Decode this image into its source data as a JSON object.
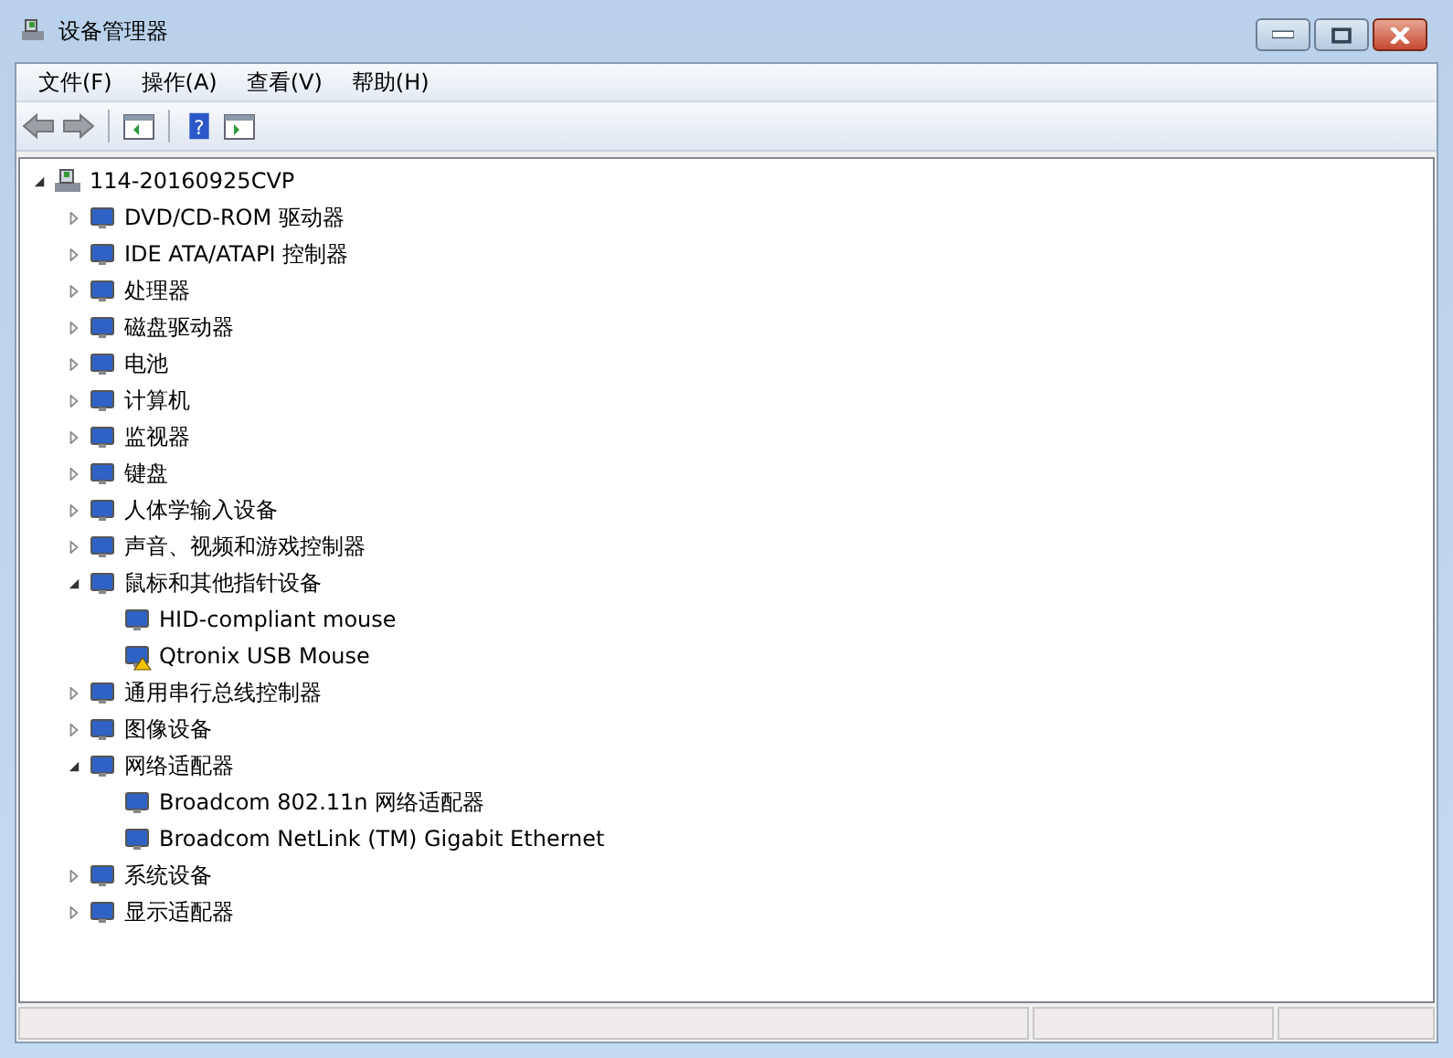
{
  "window": {
    "title": "设备管理器"
  },
  "menu": [
    "文件(F)",
    "操作(A)",
    "查看(V)",
    "帮助(H)"
  ],
  "toolbar": {
    "help_glyph": "?"
  },
  "tree": [
    {
      "label": "114-20160925CVP",
      "expanded": true,
      "children": [
        {
          "label": "DVD/CD-ROM 驱动器",
          "expanded": false
        },
        {
          "label": "IDE ATA/ATAPI 控制器",
          "expanded": false
        },
        {
          "label": "处理器",
          "expanded": false
        },
        {
          "label": "磁盘驱动器",
          "expanded": false
        },
        {
          "label": "电池",
          "expanded": false
        },
        {
          "label": "计算机",
          "expanded": false
        },
        {
          "label": "监视器",
          "expanded": false
        },
        {
          "label": "键盘",
          "expanded": false
        },
        {
          "label": "人体学输入设备",
          "expanded": false
        },
        {
          "label": "声音、视频和游戏控制器",
          "expanded": false
        },
        {
          "label": "鼠标和其他指针设备",
          "expanded": true,
          "children": [
            {
              "label": "HID-compliant mouse",
              "warning": false
            },
            {
              "label": "Qtronix USB Mouse",
              "warning": true
            }
          ]
        },
        {
          "label": "通用串行总线控制器",
          "expanded": false
        },
        {
          "label": "图像设备",
          "expanded": false
        },
        {
          "label": "网络适配器",
          "expanded": true,
          "children": [
            {
              "label": "Broadcom 802.11n 网络适配器",
              "warning": false
            },
            {
              "label": "Broadcom NetLink (TM) Gigabit Ethernet",
              "warning": false
            }
          ]
        },
        {
          "label": "系统设备",
          "expanded": false
        },
        {
          "label": "显示适配器",
          "expanded": false
        }
      ]
    }
  ]
}
